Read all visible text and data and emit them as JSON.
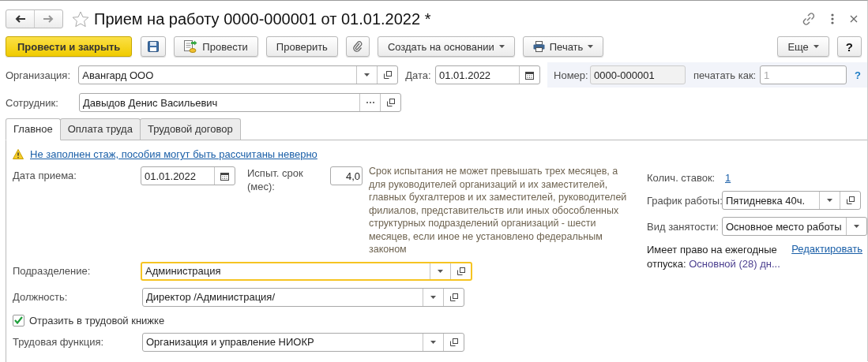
{
  "window": {
    "title": "Прием на работу 0000-000001 от 01.01.2022 *"
  },
  "toolbar": [
    {
      "kind": "primary",
      "label": "Провести и закрыть"
    },
    {
      "kind": "save"
    },
    {
      "kind": "post",
      "label": "Провести"
    },
    {
      "kind": "plain",
      "label": "Проверить"
    },
    {
      "kind": "attach"
    },
    {
      "kind": "menu",
      "label": "Создать на основании"
    },
    {
      "kind": "print",
      "label": "Печать"
    },
    {
      "kind": "spacer"
    },
    {
      "kind": "menu",
      "label": "Еще"
    },
    {
      "kind": "plain",
      "label": "?"
    }
  ],
  "header": {
    "organization": {
      "label": "Организация:",
      "value": "Авангард ООО"
    },
    "date": {
      "label": "Дата:",
      "value": "01.01.2022"
    },
    "number": {
      "label": "Номер:",
      "value": "0000-000001"
    },
    "print_as": {
      "label": "печатать как:",
      "placeholder": "1"
    },
    "help": "?",
    "employee": {
      "label": "Сотрудник:",
      "value": "Давыдов Денис Васильевич"
    }
  },
  "tabs": [
    {
      "label": "Главное",
      "selected": true
    },
    {
      "label": "Оплата труда",
      "selected": false
    },
    {
      "label": "Трудовой договор",
      "selected": false
    }
  ],
  "main": {
    "warning": "Не заполнен стаж, пособия могут быть рассчитаны неверно",
    "hire_date": {
      "label": "Дата приема:",
      "value": "01.01.2022"
    },
    "probation": {
      "label": "Испыт. срок (мес):",
      "value": "4,0"
    },
    "probation_note": "Срок испытания не может превышать трех месяцев, а для руководителей организаций и их заместителей, главных бухгалтеров и их заместителей, руководителей филиалов, представительств или иных обособленных структурных подразделений организаций - шести месяцев, если иное не установлено федеральным законом",
    "department": {
      "label": "Подразделение:",
      "value": "Администрация",
      "focused": true
    },
    "position": {
      "label": "Должность:",
      "value": "Директор /Администрация/",
      "focused": false
    },
    "workbook": {
      "label": "Отразить в трудовой книжке",
      "checked": true
    },
    "labor_function": {
      "label": "Трудовая функция:",
      "value": "Организация и управление НИОКР",
      "focused": false
    },
    "rates": {
      "label": "Колич. ставок:",
      "value": "1"
    },
    "schedule": {
      "label": "График работы:",
      "value": "Пятидневка 40ч."
    },
    "employment": {
      "label": "Вид занятости:",
      "value": "Основное место работы"
    },
    "vacation": {
      "label": "Имеет право на ежегодные отпуска:",
      "value": "Основной (28) дн...",
      "edit": "Редактировать"
    }
  }
}
